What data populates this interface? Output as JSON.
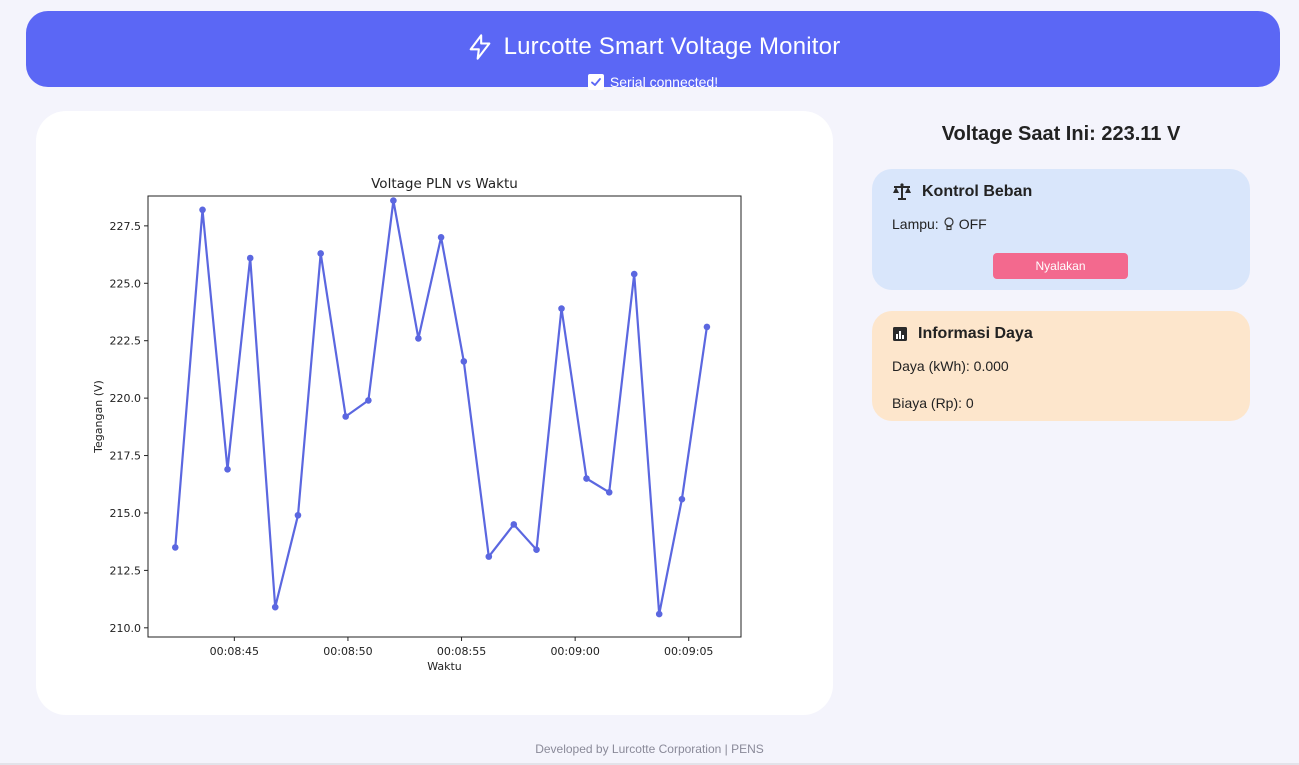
{
  "header": {
    "title": "Lurcotte Smart Voltage Monitor",
    "status": "Serial connected!",
    "accent_color": "#5b67f5",
    "icon": "lightning-icon",
    "status_icon": "checkbox-checked-icon"
  },
  "voltage_now": "Voltage Saat Ini: 223.11 V",
  "kontrol_beban": {
    "title": "Kontrol Beban",
    "icon": "scale-icon",
    "lamp_label": "Lampu:",
    "lamp_icon": "lightbulb-icon",
    "lamp_state": "OFF",
    "button_label": "Nyalakan",
    "button_color": "#f3698e",
    "card_color": "#d9e6fb"
  },
  "informasi_daya": {
    "title": "Informasi Daya",
    "icon": "bar-chart-icon",
    "daya_text": "Daya (kWh): 0.000",
    "biaya_text": "Biaya (Rp): 0",
    "card_color": "#fde6cc"
  },
  "footer": "Developed by Lurcotte Corporation | PENS",
  "chart_data": {
    "type": "line",
    "title": "Voltage PLN vs Waktu",
    "xlabel": "Waktu",
    "ylabel": "Tegangan (V)",
    "series_color": "#5b67e0",
    "ylim": [
      209.6,
      228.8
    ],
    "xlim": [
      "00:08:41.2",
      "00:09:07.3"
    ],
    "yticks": [
      "210.0",
      "212.5",
      "215.0",
      "217.5",
      "220.0",
      "222.5",
      "225.0",
      "227.5"
    ],
    "xticks": [
      "00:08:45",
      "00:08:50",
      "00:08:55",
      "00:09:00",
      "00:09:05"
    ],
    "grid": false,
    "x": [
      "00:08:42.4",
      "00:08:43.6",
      "00:08:44.7",
      "00:08:45.7",
      "00:08:46.8",
      "00:08:47.8",
      "00:08:48.8",
      "00:08:49.9",
      "00:08:50.9",
      "00:08:52.0",
      "00:08:53.1",
      "00:08:54.1",
      "00:08:55.1",
      "00:08:56.2",
      "00:08:57.3",
      "00:08:58.3",
      "00:08:59.4",
      "00:09:00.5",
      "00:09:01.5",
      "00:09:02.6",
      "00:09:03.7",
      "00:09:04.7",
      "00:09:05.8"
    ],
    "values": [
      213.5,
      228.2,
      216.9,
      226.1,
      210.9,
      214.9,
      226.3,
      219.2,
      219.9,
      228.6,
      222.6,
      227.0,
      221.6,
      213.1,
      214.5,
      213.4,
      223.9,
      216.5,
      215.9,
      225.4,
      210.6,
      215.6,
      223.1
    ]
  }
}
